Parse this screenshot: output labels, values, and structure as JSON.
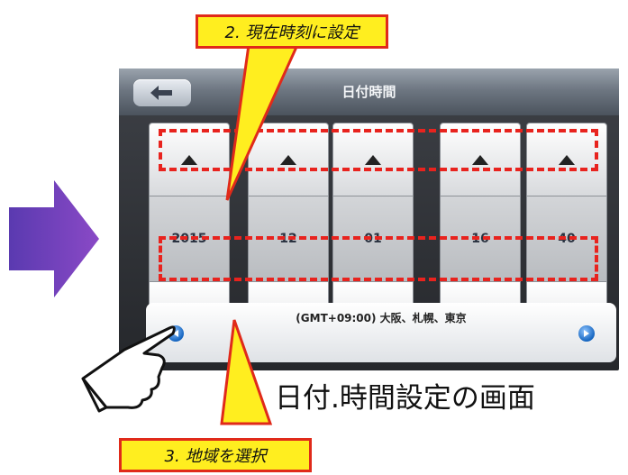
{
  "screen": {
    "title": "日付時間",
    "columns": [
      {
        "label": "year",
        "value": "2015"
      },
      {
        "label": "month",
        "value": "12"
      },
      {
        "label": "day",
        "value": "01"
      },
      {
        "label": "hour",
        "value": "16"
      },
      {
        "label": "minute",
        "value": "40"
      }
    ],
    "timezone": "(GMT+09:00) 大阪、札幌、東京"
  },
  "annotations": {
    "step2": "2. 現在時刻に設定",
    "step3": "3. 地域を選択",
    "caption": "日付.時間設定の画面"
  },
  "colors": {
    "highlight": "#e8231e",
    "callout_fill": "#ffee1f",
    "accent_arrow": "#6a3fb5"
  }
}
